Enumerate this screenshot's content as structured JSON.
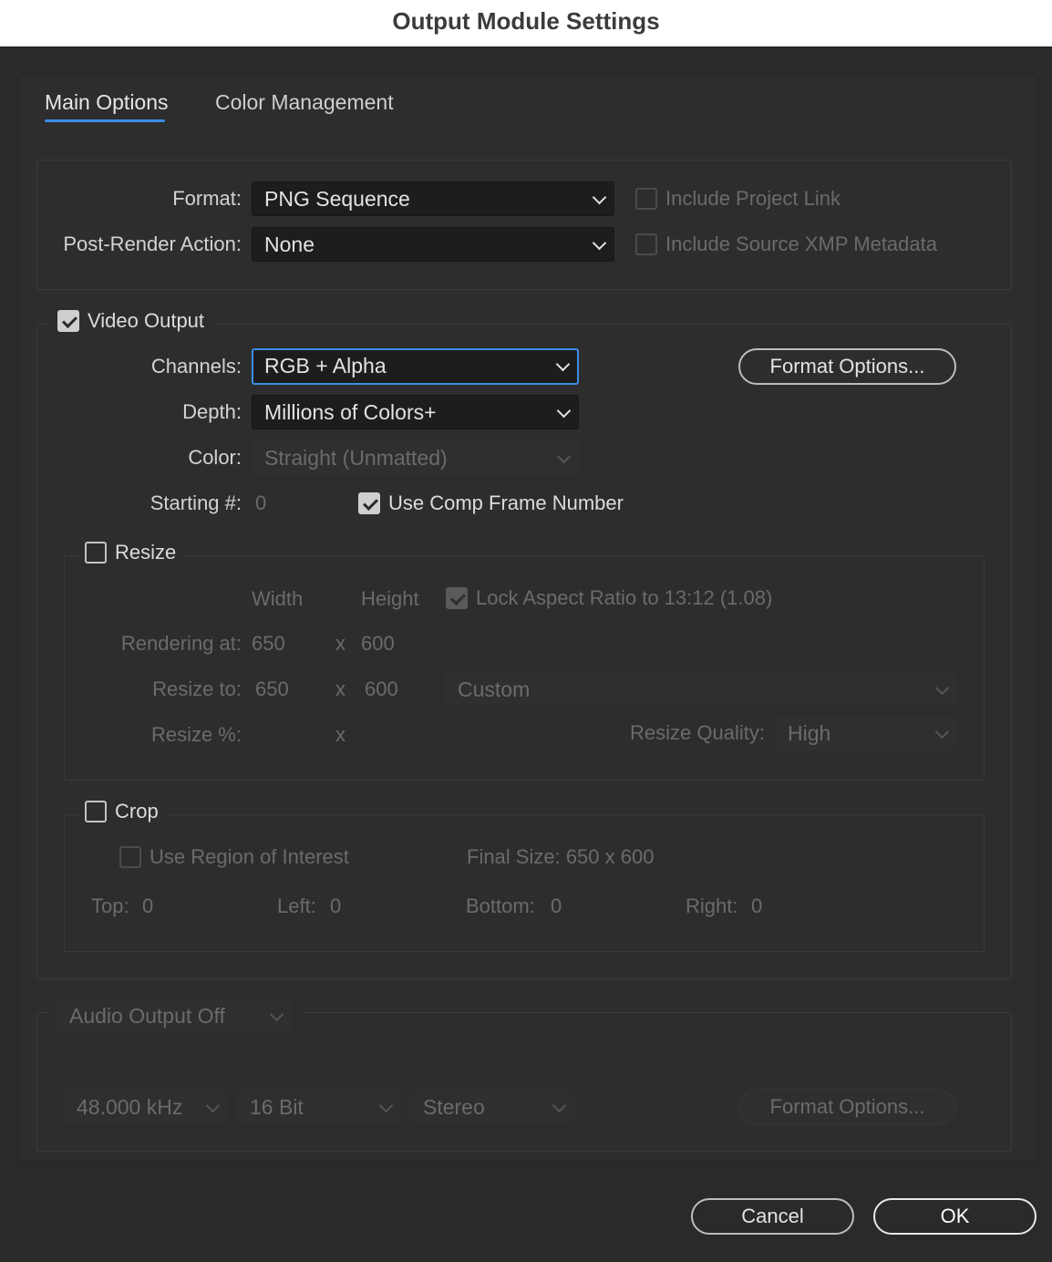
{
  "window": {
    "title": "Output Module Settings"
  },
  "tabs": [
    {
      "label": "Main Options",
      "active": true
    },
    {
      "label": "Color Management",
      "active": false
    }
  ],
  "general": {
    "format_label": "Format:",
    "format_value": "PNG Sequence",
    "post_render_label": "Post-Render Action:",
    "post_render_value": "None",
    "include_project_link": {
      "label": "Include Project Link",
      "checked": false,
      "enabled": false
    },
    "include_xmp": {
      "label": "Include Source XMP Metadata",
      "checked": false,
      "enabled": false
    }
  },
  "video": {
    "header": {
      "label": "Video Output",
      "checked": true
    },
    "channels_label": "Channels:",
    "channels_value": "RGB + Alpha",
    "format_options_button": "Format Options...",
    "depth_label": "Depth:",
    "depth_value": "Millions of Colors+",
    "color_label": "Color:",
    "color_value": "Straight (Unmatted)",
    "starting_label": "Starting #:",
    "starting_value": "0",
    "use_comp_frame": {
      "label": "Use Comp Frame Number",
      "checked": true
    }
  },
  "resize": {
    "header": {
      "label": "Resize",
      "checked": false
    },
    "width_header": "Width",
    "height_header": "Height",
    "lock_aspect": {
      "label": "Lock Aspect Ratio to 13:12 (1.08)",
      "checked": true,
      "enabled": false
    },
    "rendering_at_label": "Rendering at:",
    "rendering_width": "650",
    "rendering_x": "x",
    "rendering_height": "600",
    "resize_to_label": "Resize to:",
    "resize_to_width": "650",
    "resize_to_x": "x",
    "resize_to_height": "600",
    "preset_value": "Custom",
    "resize_pct_label": "Resize %:",
    "resize_pct_x": "x",
    "quality_label": "Resize Quality:",
    "quality_value": "High"
  },
  "crop": {
    "header": {
      "label": "Crop",
      "checked": false
    },
    "use_roi": {
      "label": "Use Region of Interest",
      "checked": false,
      "enabled": false
    },
    "final_size": "Final Size: 650 x 600",
    "top_label": "Top:",
    "top_value": "0",
    "left_label": "Left:",
    "left_value": "0",
    "bottom_label": "Bottom:",
    "bottom_value": "0",
    "right_label": "Right:",
    "right_value": "0"
  },
  "audio": {
    "mode_value": "Audio Output Off",
    "sample_rate": "48.000 kHz",
    "bit_depth": "16 Bit",
    "channels": "Stereo",
    "format_options_button": "Format Options..."
  },
  "footer": {
    "cancel": "Cancel",
    "ok": "OK"
  },
  "colors": {
    "accent": "#3a8ee6",
    "background": "#2a2a2a",
    "panel": "#2d2d2d",
    "field": "#1d1d1d"
  }
}
